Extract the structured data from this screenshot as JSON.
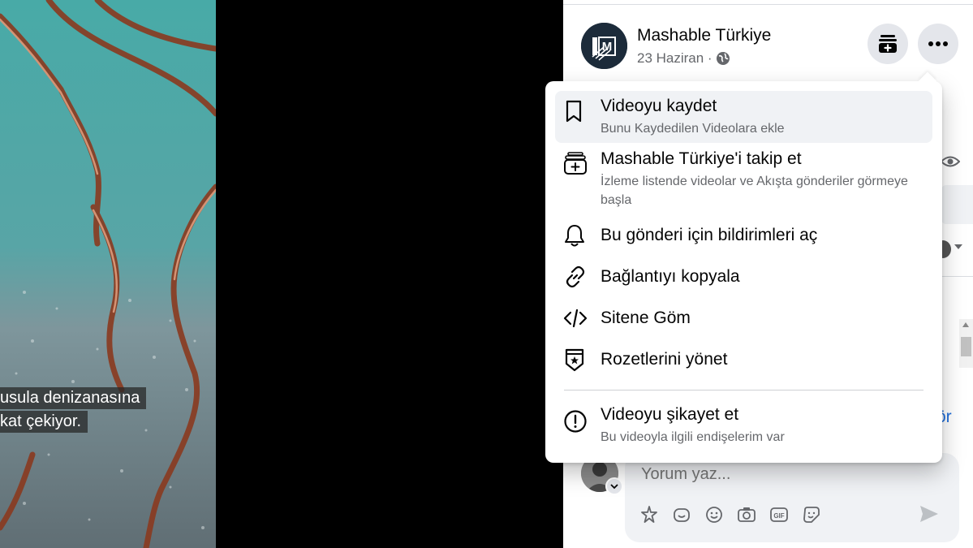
{
  "video": {
    "subtitle_line1": "usula denizanasına",
    "subtitle_line2": "kat çekiyor."
  },
  "post": {
    "page_name": "Mashable Türkiye",
    "date": "23 Haziran ·",
    "avatar_letter": "M",
    "see_more_fragment": "ör"
  },
  "menu": {
    "items": [
      {
        "title": "Videoyu kaydet",
        "desc": "Bunu Kaydedilen Videolara ekle",
        "icon": "bookmark-icon"
      },
      {
        "title": "Mashable Türkiye'i takip et",
        "desc": "İzleme listende videolar ve Akışta gönderiler görmeye başla",
        "icon": "follow-add-icon"
      },
      {
        "title": "Bu gönderi için bildirimleri aç",
        "icon": "bell-icon"
      },
      {
        "title": "Bağlantıyı kopyala",
        "icon": "link-icon"
      },
      {
        "title": "Sitene Göm",
        "icon": "code-icon"
      },
      {
        "title": "Rozetlerini yönet",
        "icon": "badge-icon"
      },
      {
        "title": "Videoyu şikayet et",
        "desc": "Bu videoyla ilgili endişelerim var",
        "icon": "report-icon"
      }
    ]
  },
  "comment": {
    "placeholder": "Yorum yaz..."
  },
  "colors": {
    "link_blue": "#216fdb",
    "hover_bg": "#f0f2f5",
    "secondary_text": "#65676b"
  }
}
